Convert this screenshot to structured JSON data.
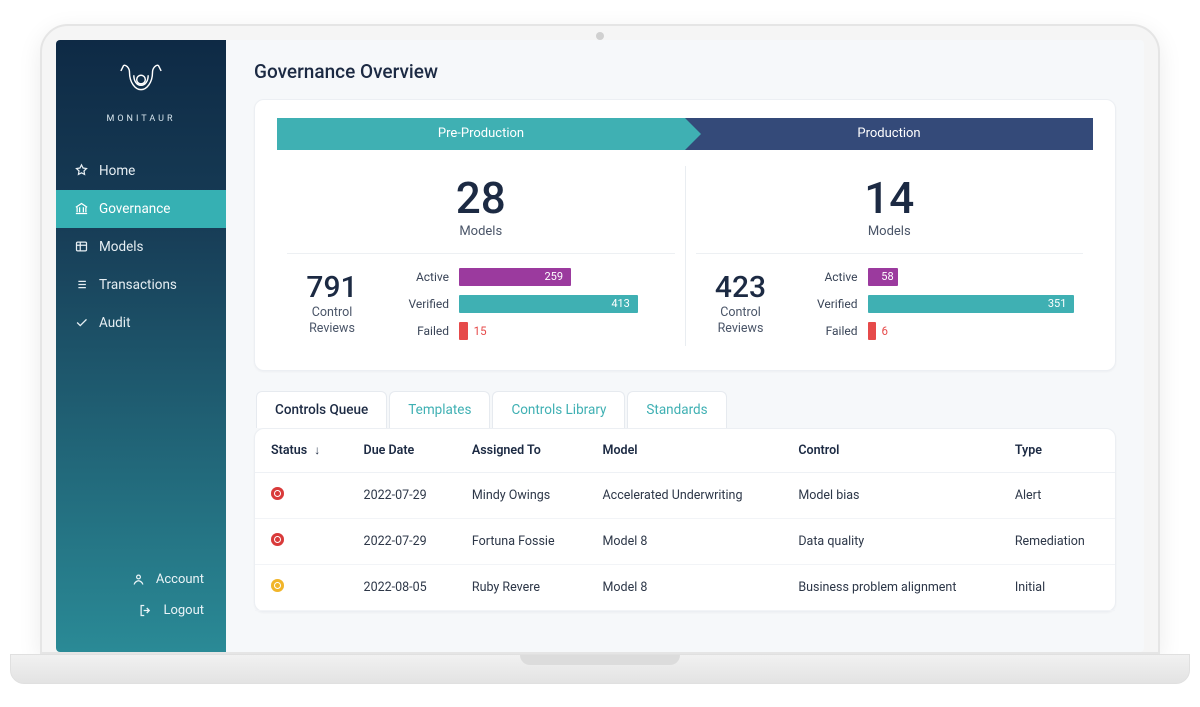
{
  "brand": {
    "name": "MONITAUR"
  },
  "nav": {
    "items": [
      {
        "key": "home",
        "label": "Home"
      },
      {
        "key": "governance",
        "label": "Governance"
      },
      {
        "key": "models",
        "label": "Models"
      },
      {
        "key": "transactions",
        "label": "Transactions"
      },
      {
        "key": "audit",
        "label": "Audit"
      }
    ],
    "active": "governance",
    "footer": [
      {
        "key": "account",
        "label": "Account"
      },
      {
        "key": "logout",
        "label": "Logout"
      }
    ]
  },
  "page": {
    "title": "Governance Overview"
  },
  "phases": {
    "pre": {
      "label": "Pre-Production"
    },
    "prod": {
      "label": "Production"
    }
  },
  "summary": {
    "models_label": "Models",
    "reviews_label_line1": "Control",
    "reviews_label_line2": "Reviews",
    "status_labels": {
      "active": "Active",
      "verified": "Verified",
      "failed": "Failed"
    },
    "pre": {
      "models": 28,
      "reviews_total": 791,
      "active": 259,
      "verified": 413,
      "failed": 15
    },
    "prod": {
      "models": 14,
      "reviews_total": 423,
      "active": 58,
      "verified": 351,
      "failed": 6
    }
  },
  "chart_data": [
    {
      "type": "bar",
      "title": "Pre-Production Control Reviews",
      "categories": [
        "Active",
        "Verified",
        "Failed"
      ],
      "values": [
        259,
        413,
        15
      ],
      "xlim": [
        0,
        791
      ]
    },
    {
      "type": "bar",
      "title": "Production Control Reviews",
      "categories": [
        "Active",
        "Verified",
        "Failed"
      ],
      "values": [
        58,
        351,
        6
      ],
      "xlim": [
        0,
        423
      ]
    }
  ],
  "tabs": {
    "items": [
      {
        "key": "queue",
        "label": "Controls Queue"
      },
      {
        "key": "templates",
        "label": "Templates"
      },
      {
        "key": "library",
        "label": "Controls Library"
      },
      {
        "key": "standards",
        "label": "Standards"
      }
    ],
    "active": "queue"
  },
  "table": {
    "columns": {
      "status": "Status",
      "due": "Due Date",
      "assigned": "Assigned To",
      "model": "Model",
      "control": "Control",
      "type": "Type"
    },
    "sort_indicator": "↓",
    "rows": [
      {
        "status": "error",
        "due": "2022-07-29",
        "assigned": "Mindy Owings",
        "model": "Accelerated Underwriting",
        "control": "Model bias",
        "type": "Alert"
      },
      {
        "status": "error",
        "due": "2022-07-29",
        "assigned": "Fortuna Fossie",
        "model": "Model 8",
        "control": "Data quality",
        "type": "Remediation"
      },
      {
        "status": "warn",
        "due": "2022-08-05",
        "assigned": "Ruby Revere",
        "model": "Model 8",
        "control": "Business problem alignment",
        "type": "Initial"
      }
    ]
  }
}
